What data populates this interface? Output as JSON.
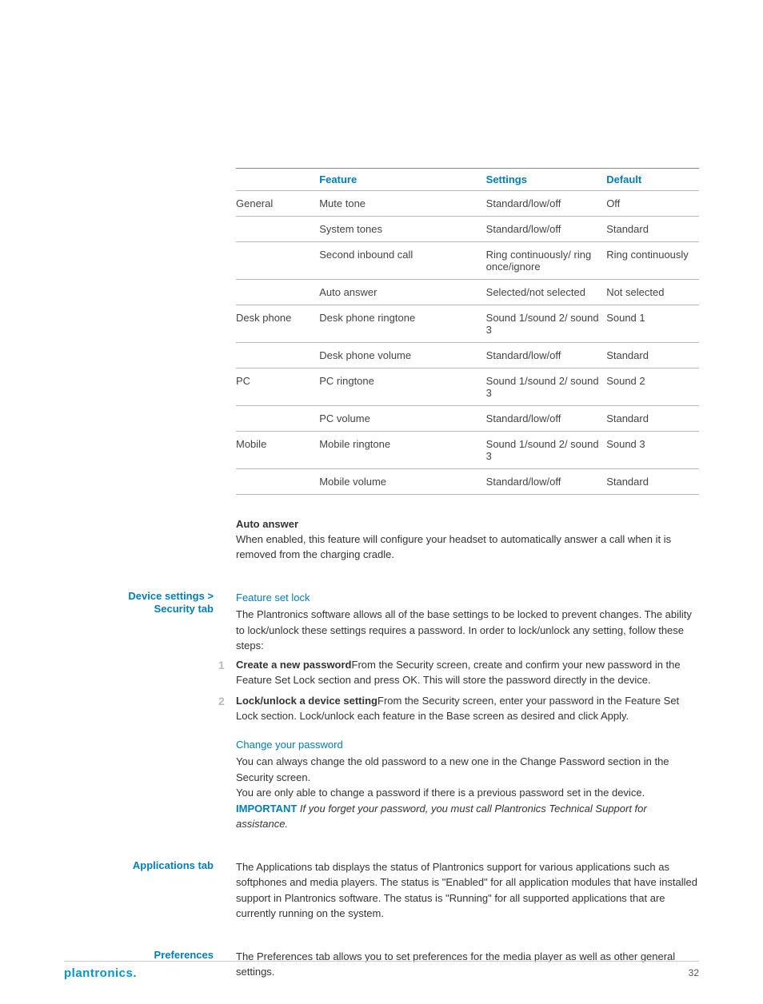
{
  "table": {
    "headers": {
      "cat": "",
      "feature": "Feature",
      "settings": "Settings",
      "default": "Default"
    },
    "rows": [
      {
        "cat": "General",
        "feature": "Mute tone",
        "settings": "Standard/low/off",
        "default": "Off"
      },
      {
        "cat": "",
        "feature": "System tones",
        "settings": "Standard/low/off",
        "default": "Standard"
      },
      {
        "cat": "",
        "feature": "Second inbound call",
        "settings": "Ring continuously/ ring once/ignore",
        "default": "Ring continuously"
      },
      {
        "cat": "",
        "feature": "Auto answer",
        "settings": "Selected/not selected",
        "default": "Not selected"
      },
      {
        "cat": "Desk phone",
        "feature": "Desk phone ringtone",
        "settings": "Sound 1/sound 2/ sound 3",
        "default": "Sound 1"
      },
      {
        "cat": "",
        "feature": "Desk phone volume",
        "settings": "Standard/low/off",
        "default": "Standard"
      },
      {
        "cat": "PC",
        "feature": "PC ringtone",
        "settings": "Sound 1/sound 2/ sound 3",
        "default": "Sound 2"
      },
      {
        "cat": "",
        "feature": "PC volume",
        "settings": "Standard/low/off",
        "default": "Standard"
      },
      {
        "cat": "Mobile",
        "feature": "Mobile ringtone",
        "settings": "Sound 1/sound 2/ sound 3",
        "default": "Sound 3"
      },
      {
        "cat": "",
        "feature": "Mobile volume",
        "settings": "Standard/low/off",
        "default": "Standard"
      }
    ]
  },
  "auto_answer": {
    "title": "Auto answer",
    "body": "When enabled, this feature will configure your headset to automatically answer a call when it is removed from the charging cradle."
  },
  "security": {
    "side_label_l1": "Device settings >",
    "side_label_l2": "Security tab",
    "feature_lock_head": "Feature set lock",
    "feature_lock_body": "The Plantronics software allows all of the base settings to be locked to prevent changes. The ability to lock/unlock these settings requires a password. In order to lock/unlock any setting, follow these steps:",
    "steps": [
      {
        "bold": "Create a new password",
        "rest": "From the Security screen, create and confirm your new password in the Feature Set Lock section and press OK. This will store the password directly in the device."
      },
      {
        "bold": "Lock/unlock a device setting",
        "rest": "From the Security screen, enter your password in the Feature Set Lock section. Lock/unlock each feature in the Base screen as desired and click Apply."
      }
    ],
    "change_pw_head": "Change your password",
    "change_pw_l1": "You can always change the old password to a new one in the Change Password section in the Security screen.",
    "change_pw_l2": "You are only able to change a password if there is a previous password set in the device.",
    "important_label": "IMPORTANT",
    "important_text": " If you forget your password, you must call Plantronics Technical Support for assistance."
  },
  "applications": {
    "side_label": "Applications tab",
    "body": "The Applications tab displays the status of Plantronics support for various applications such as softphones and media players. The status is \"Enabled\" for all application modules that have installed support in Plantronics software. The status is \"Running\" for all supported applications that are currently running on the system."
  },
  "preferences": {
    "side_label": "Preferences",
    "body": "The Preferences tab allows you to set preferences for the media player as well as other general settings."
  },
  "footer": {
    "logo": "plantronics",
    "dot": ".",
    "page": "32"
  }
}
